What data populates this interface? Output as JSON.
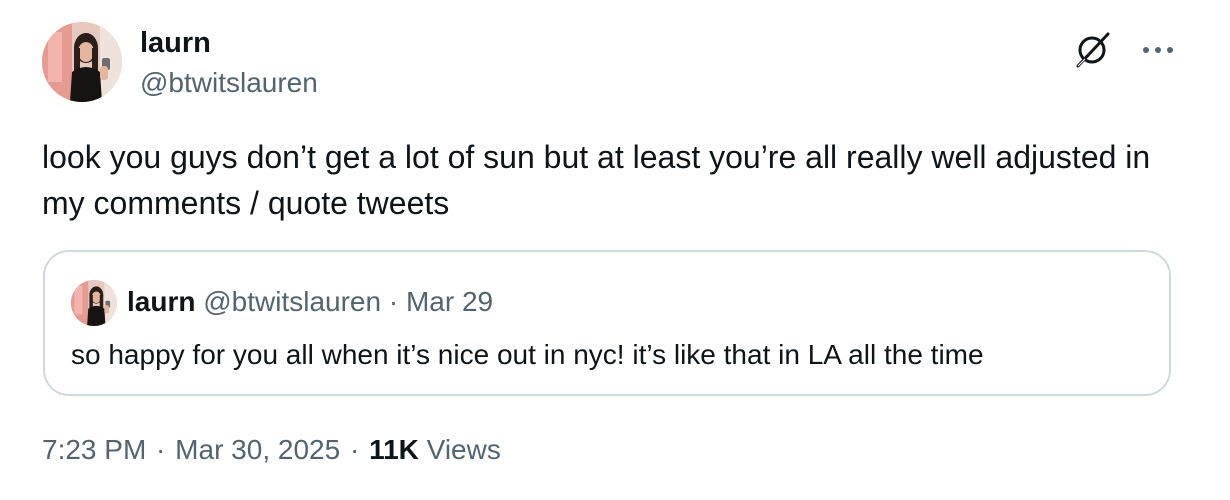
{
  "author": {
    "display_name": "laurn",
    "handle": "@btwitslauren"
  },
  "icons": {
    "grok": "grok-icon",
    "more": "more-horizontal-icon"
  },
  "tweet": {
    "text": "look you guys don’t get a lot of sun but at least you’re all really well adjusted in my comments / quote tweets"
  },
  "quoted_tweet": {
    "display_name": "laurn",
    "handle": "@btwitslauren",
    "separator": " · ",
    "date": "Mar 29",
    "text": "so happy for you all when it’s nice out in nyc! it’s like that in LA all the time"
  },
  "footer": {
    "time": "7:23 PM",
    "separator": " · ",
    "date": "Mar 30, 2025",
    "views_count": "11K",
    "views_label": " Views"
  },
  "colors": {
    "text_primary": "#0f1419",
    "text_secondary": "#536471",
    "border": "#cfd9de"
  }
}
